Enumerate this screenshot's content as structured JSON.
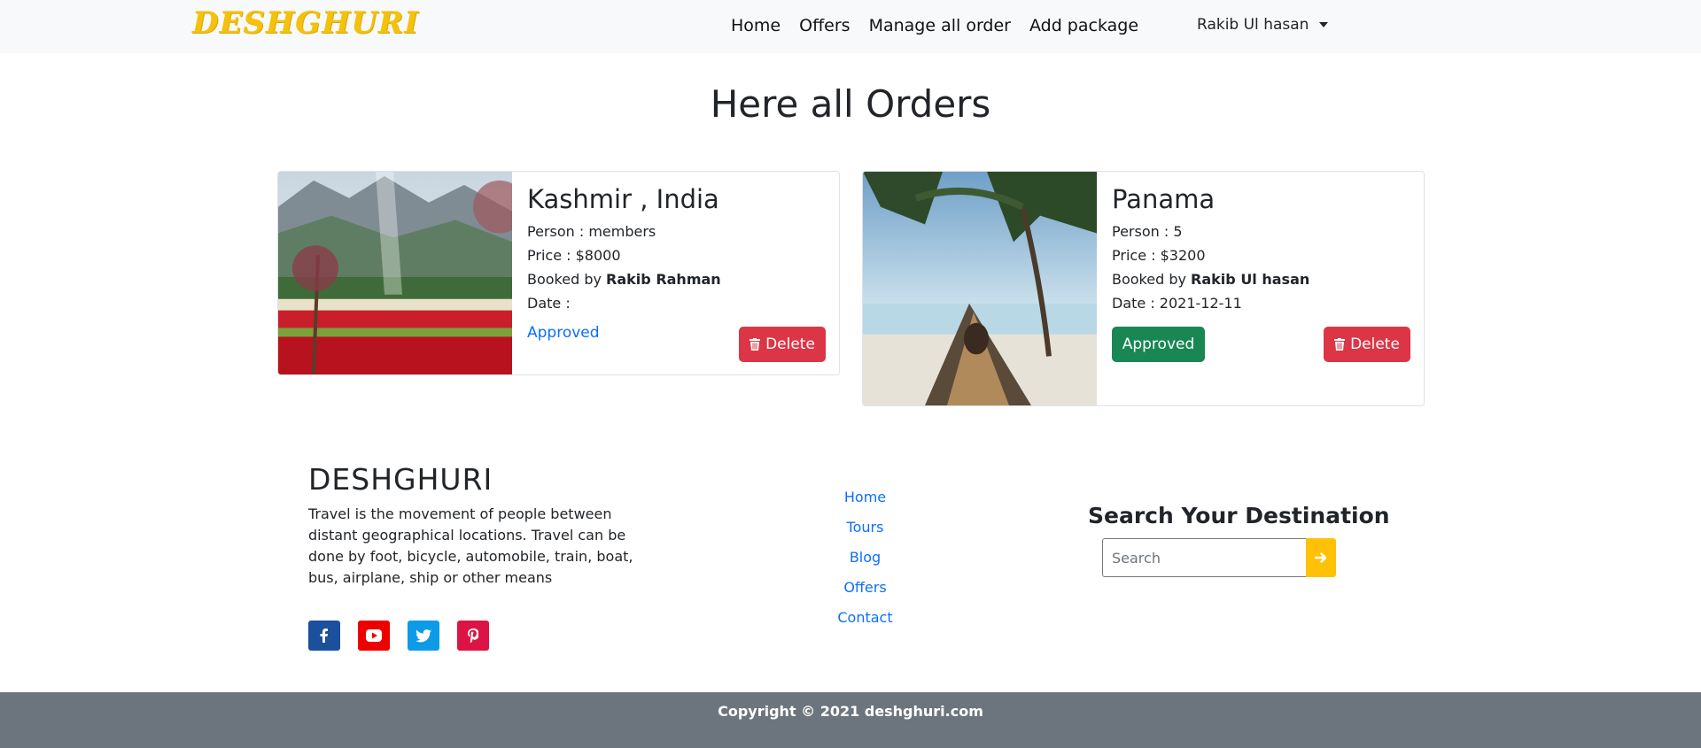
{
  "navbar": {
    "brand": "DESHGHURI",
    "links": [
      "Home",
      "Offers",
      "Manage all order",
      "Add package"
    ],
    "user": "Rakib Ul hasan"
  },
  "page": {
    "title": "Here all Orders"
  },
  "orders": [
    {
      "title": "Kashmir , India",
      "person": "Person : members",
      "price": "Price : $8000",
      "booked_prefix": "Booked by ",
      "booked_by": "Rakib Rahman",
      "date": "Date :",
      "status": "Approved",
      "delete_label": "Delete"
    },
    {
      "title": "Panama",
      "person": "Person : 5",
      "price": "Price : $3200",
      "booked_prefix": "Booked by ",
      "booked_by": "Rakib Ul hasan",
      "date": "Date : 2021-12-11",
      "status": "Approved",
      "delete_label": "Delete"
    }
  ],
  "footer": {
    "brand": "DESHGHURI",
    "description": "Travel is the movement of people between distant geographical locations. Travel can be done by foot, bicycle, automobile, train, boat, bus, airplane, ship or other means",
    "links": [
      "Home",
      "Tours",
      "Blog",
      "Offers",
      "Contact"
    ],
    "socials": [
      "facebook-icon",
      "youtube-icon",
      "twitter-icon",
      "pinterest-icon"
    ],
    "search_title": "Search Your Destination",
    "search_placeholder": "Search",
    "copyright": "Copyright © 2021 deshghuri.com"
  },
  "colors": {
    "brand": "#f4c20d",
    "primary": "#0d6efd",
    "success": "#198754",
    "danger": "#dc3545",
    "warning": "#ffc107",
    "footer_bar": "#6c757d"
  }
}
